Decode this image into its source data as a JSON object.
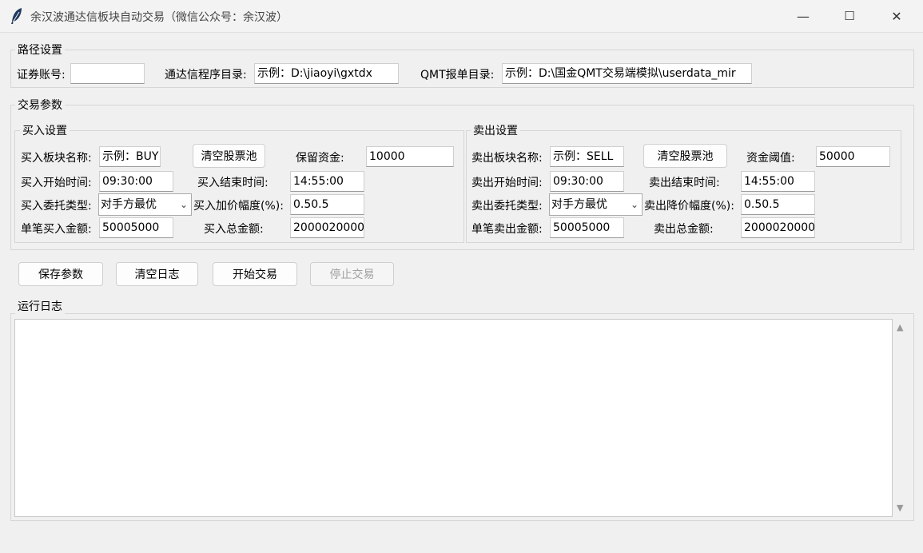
{
  "window": {
    "title": "余汉波通达信板块自动交易（微信公众号：余汉波）",
    "minimize": "—",
    "maximize": "☐",
    "close": "✕"
  },
  "path": {
    "group_label": "路径设置",
    "account_label": "证券账号:",
    "account_value": "",
    "tdx_label": "通达信程序目录:",
    "tdx_value": "示例：D:\\jiaoyi\\gxtdx",
    "qmt_label": "QMT报单目录:",
    "qmt_value": "示例：D:\\国金QMT交易端模拟\\userdata_mir"
  },
  "trade": {
    "group_label": "交易参数",
    "buy": {
      "group_label": "买入设置",
      "block_label": "买入板块名称:",
      "block_value": "示例：BUY",
      "clear_pool": "清空股票池",
      "reserve_label": "保留资金:",
      "reserve_value": "10000",
      "start_label": "买入开始时间:",
      "start_value": "09:30:00",
      "end_label": "买入结束时间:",
      "end_value": "14:55:00",
      "order_type_label": "买入委托类型:",
      "order_type_value": "对手方最优",
      "markup_label": "买入加价幅度(%):",
      "markup_value": "0.50.5",
      "single_label": "单笔买入金额:",
      "single_value": "50005000",
      "total_label": "买入总金额:",
      "total_value": "2000020000"
    },
    "sell": {
      "group_label": "卖出设置",
      "block_label": "卖出板块名称:",
      "block_value": "示例：SELL",
      "clear_pool": "清空股票池",
      "threshold_label": "资金阈值:",
      "threshold_value": "50000",
      "start_label": "卖出开始时间:",
      "start_value": "09:30:00",
      "end_label": "卖出结束时间:",
      "end_value": "14:55:00",
      "order_type_label": "卖出委托类型:",
      "order_type_value": "对手方最优",
      "markdown_label": "卖出降价幅度(%):",
      "markdown_value": "0.50.5",
      "single_label": "单笔卖出金额:",
      "single_value": "50005000",
      "total_label": "卖出总金额:",
      "total_value": "2000020000"
    }
  },
  "actions": {
    "save": "保存参数",
    "clear_log": "清空日志",
    "start": "开始交易",
    "stop": "停止交易"
  },
  "log": {
    "group_label": "运行日志",
    "content": "",
    "scroll_up": "▲",
    "scroll_down": "▼"
  }
}
